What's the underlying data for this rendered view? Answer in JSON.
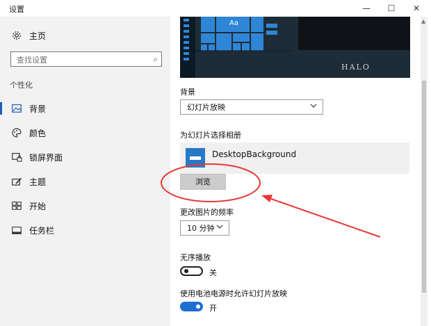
{
  "window": {
    "title": "设置",
    "minimize_glyph": "—",
    "maximize_glyph": "☐",
    "close_glyph": "✕"
  },
  "sidebar": {
    "home": {
      "label": "主页",
      "icon": "gear-icon"
    },
    "search": {
      "placeholder": "查找设置",
      "icon": "search-icon"
    },
    "section": "个性化",
    "items": [
      {
        "label": "背景",
        "icon": "picture-icon",
        "active": true
      },
      {
        "label": "颜色",
        "icon": "palette-icon",
        "active": false
      },
      {
        "label": "锁屏界面",
        "icon": "lock-screen-icon",
        "active": false
      },
      {
        "label": "主题",
        "icon": "theme-brush-icon",
        "active": false
      },
      {
        "label": "开始",
        "icon": "start-grid-icon",
        "active": false
      },
      {
        "label": "任务栏",
        "icon": "taskbar-icon",
        "active": false
      }
    ]
  },
  "main": {
    "preview": {
      "tile_text": "Aa",
      "logo_text": "HALO"
    },
    "background": {
      "label": "背景",
      "selected": "幻灯片放映"
    },
    "album": {
      "label": "为幻灯片选择相册",
      "name": "DesktopBackground",
      "icon": "folder-icon",
      "browse_label": "浏览"
    },
    "interval": {
      "label": "更改图片的频率",
      "selected": "10 分钟"
    },
    "shuffle": {
      "label": "无序播放",
      "state_text": "关",
      "on": false
    },
    "battery": {
      "label": "使用电池电源时允许幻灯片放映",
      "state_text": "开",
      "on": true
    }
  },
  "colors": {
    "accent": "#1f6fd1",
    "annotation": "#e53935",
    "sidebar_bg": "#f2f2f2"
  }
}
